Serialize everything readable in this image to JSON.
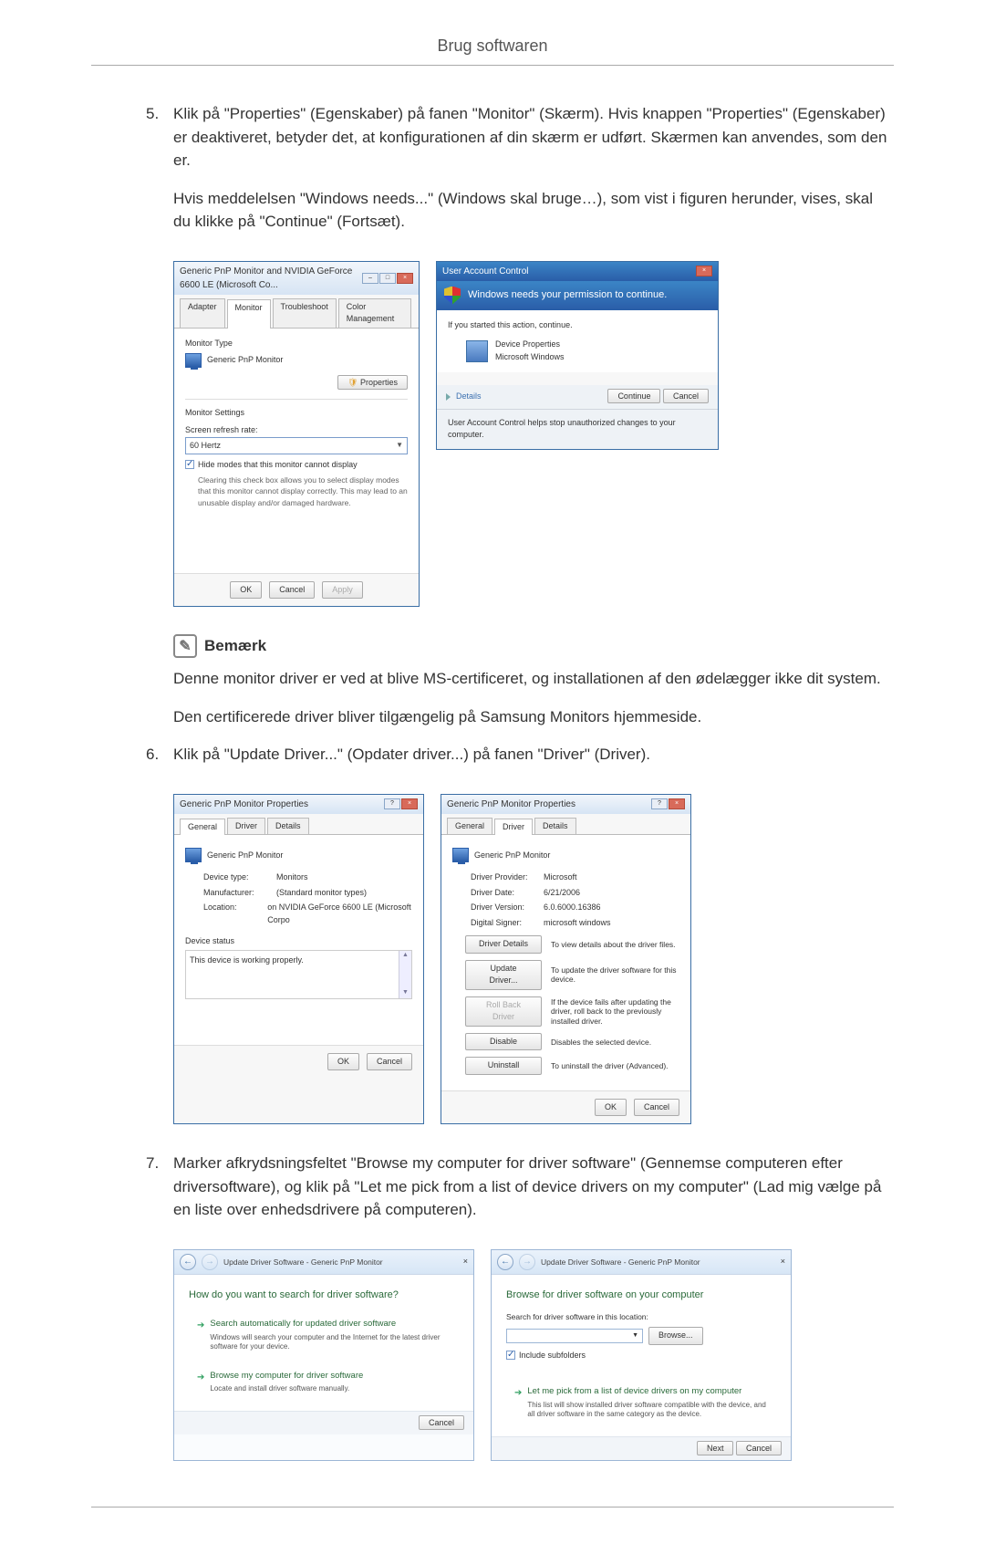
{
  "header": {
    "title": "Brug softwaren"
  },
  "steps": {
    "5": {
      "num": "5.",
      "p1": "Klik på \"Properties\" (Egenskaber) på fanen \"Monitor\" (Skærm). Hvis knappen \"Properties\" (Egenskaber) er deaktiveret, betyder det, at konfigurationen af din skærm er udført. Skærmen kan anvendes, som den er.",
      "p2": "Hvis meddelelsen \"Windows needs...\" (Windows skal bruge…), som vist i figuren herunder, vises, skal du klikke på \"Continue\" (Fortsæt)."
    },
    "6": {
      "num": "6.",
      "p1": "Klik på \"Update Driver...\" (Opdater driver...) på fanen \"Driver\" (Driver)."
    },
    "7": {
      "num": "7.",
      "p1": "Marker afkrydsningsfeltet \"Browse my computer for driver software\" (Gennemse computeren efter driversoftware), og klik på \"Let me pick from a list of device drivers on my computer\" (Lad mig vælge på en liste over enhedsdrivere på computeren)."
    }
  },
  "note": {
    "label": "Bemærk",
    "text1": "Denne monitor driver er ved at blive MS-certificeret, og installationen af den ødelægger ikke dit system.",
    "text2": "Den certificerede driver bliver tilgængelig på Samsung Monitors hjemmeside."
  },
  "dlg_monitor": {
    "title": "Generic PnP Monitor and NVIDIA GeForce 6600 LE (Microsoft Co...",
    "tabs": {
      "adapter": "Adapter",
      "monitor": "Monitor",
      "troubleshoot": "Troubleshoot",
      "color": "Color Management"
    },
    "monitor_type_label": "Monitor Type",
    "monitor_name": "Generic PnP Monitor",
    "properties_btn": "Properties",
    "settings_label": "Monitor Settings",
    "refresh_label": "Screen refresh rate:",
    "refresh_value": "60 Hertz",
    "hide_modes": "Hide modes that this monitor cannot display",
    "hide_modes_desc": "Clearing this check box allows you to select display modes that this monitor cannot display correctly. This may lead to an unusable display and/or damaged hardware.",
    "ok": "OK",
    "cancel": "Cancel",
    "apply": "Apply"
  },
  "dlg_uac": {
    "title": "User Account Control",
    "heading": "Windows needs your permission to continue.",
    "intro": "If you started this action, continue.",
    "app_name": "Device Properties",
    "app_pub": "Microsoft Windows",
    "details": "Details",
    "continue": "Continue",
    "cancel": "Cancel",
    "footer": "User Account Control helps stop unauthorized changes to your computer."
  },
  "dlg_props_general": {
    "title": "Generic PnP Monitor Properties",
    "tabs": {
      "general": "General",
      "driver": "Driver",
      "details": "Details"
    },
    "name": "Generic PnP Monitor",
    "device_type_l": "Device type:",
    "device_type_v": "Monitors",
    "manufacturer_l": "Manufacturer:",
    "manufacturer_v": "(Standard monitor types)",
    "location_l": "Location:",
    "location_v": "on NVIDIA GeForce 6600 LE (Microsoft Corpo",
    "status_l": "Device status",
    "status_v": "This device is working properly.",
    "ok": "OK",
    "cancel": "Cancel"
  },
  "dlg_props_driver": {
    "title": "Generic PnP Monitor Properties",
    "tabs": {
      "general": "General",
      "driver": "Driver",
      "details": "Details"
    },
    "name": "Generic PnP Monitor",
    "provider_l": "Driver Provider:",
    "provider_v": "Microsoft",
    "date_l": "Driver Date:",
    "date_v": "6/21/2006",
    "version_l": "Driver Version:",
    "version_v": "6.0.6000.16386",
    "signer_l": "Digital Signer:",
    "signer_v": "microsoft windows",
    "btn_details": "Driver Details",
    "desc_details": "To view details about the driver files.",
    "btn_update": "Update Driver...",
    "desc_update": "To update the driver software for this device.",
    "btn_rollback": "Roll Back Driver",
    "desc_rollback": "If the device fails after updating the driver, roll back to the previously installed driver.",
    "btn_disable": "Disable",
    "desc_disable": "Disables the selected device.",
    "btn_uninstall": "Uninstall",
    "desc_uninstall": "To uninstall the driver (Advanced).",
    "ok": "OK",
    "cancel": "Cancel"
  },
  "dlg_wiz_search": {
    "breadcrumb": "Update Driver Software - Generic PnP Monitor",
    "heading": "How do you want to search for driver software?",
    "opt1_title": "Search automatically for updated driver software",
    "opt1_desc": "Windows will search your computer and the Internet for the latest driver software for your device.",
    "opt2_title": "Browse my computer for driver software",
    "opt2_desc": "Locate and install driver software manually.",
    "cancel": "Cancel"
  },
  "dlg_wiz_browse": {
    "breadcrumb": "Update Driver Software - Generic PnP Monitor",
    "heading": "Browse for driver software on your computer",
    "search_label": "Search for driver software in this location:",
    "path_value": "",
    "browse_btn": "Browse...",
    "include_sub": "Include subfolders",
    "opt_title": "Let me pick from a list of device drivers on my computer",
    "opt_desc": "This list will show installed driver software compatible with the device, and all driver software in the same category as the device.",
    "next": "Next",
    "cancel": "Cancel"
  }
}
